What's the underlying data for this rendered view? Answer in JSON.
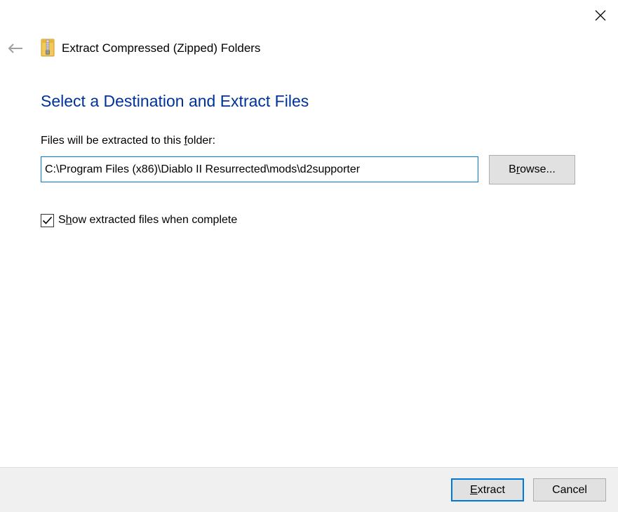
{
  "window": {
    "title": "Extract Compressed (Zipped) Folders",
    "close_icon": "close-icon",
    "back_icon": "back-arrow-icon",
    "title_icon": "zipped-folder-icon"
  },
  "main": {
    "heading": "Select a Destination and Extract Files",
    "field_label_pre": "Files will be extracted to this ",
    "field_label_accel": "f",
    "field_label_post": "older:",
    "path_value": "C:\\Program Files (x86)\\Diablo II Resurrected\\mods\\d2supporter",
    "browse_pre": "B",
    "browse_accel": "r",
    "browse_post": "owse...",
    "show_files": {
      "checked": true,
      "label_pre": "S",
      "label_accel": "h",
      "label_post": "ow extracted files when complete"
    }
  },
  "footer": {
    "extract_accel": "E",
    "extract_post": "xtract",
    "cancel_label": "Cancel"
  },
  "colors": {
    "heading": "#003399",
    "focus_border": "#0078d7",
    "button_bg": "#e1e1e1",
    "footer_bg": "#f0f0f0"
  }
}
